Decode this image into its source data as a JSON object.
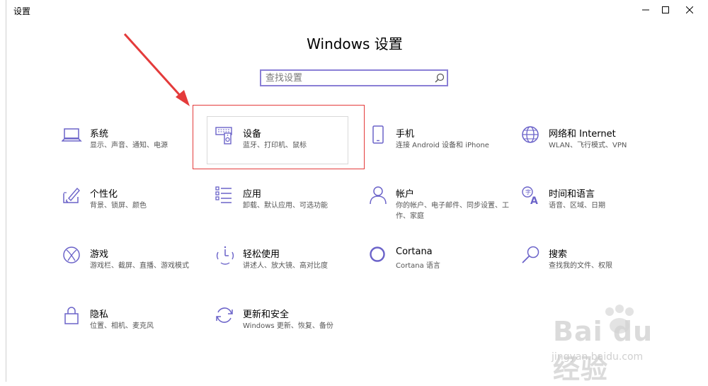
{
  "window": {
    "title": "设置",
    "controls": {
      "minimize": "─",
      "maximize": "☐",
      "close": "✕"
    }
  },
  "header": {
    "title": "Windows 设置",
    "search_placeholder": "查找设置"
  },
  "tiles": [
    {
      "id": "system",
      "title": "系统",
      "subtitle": "显示、声音、通知、电源",
      "icon": "laptop-icon"
    },
    {
      "id": "devices",
      "title": "设备",
      "subtitle": "蓝牙、打印机、鼠标",
      "icon": "keyboard-speaker-icon"
    },
    {
      "id": "phone",
      "title": "手机",
      "subtitle": "连接 Android 设备和 iPhone",
      "icon": "phone-icon"
    },
    {
      "id": "network",
      "title": "网络和 Internet",
      "subtitle": "WLAN、飞行模式、VPN",
      "icon": "globe-icon"
    },
    {
      "id": "personalization",
      "title": "个性化",
      "subtitle": "背景、锁屏、颜色",
      "icon": "pen-tablet-icon"
    },
    {
      "id": "apps",
      "title": "应用",
      "subtitle": "卸载、默认应用、可选功能",
      "icon": "apps-list-icon"
    },
    {
      "id": "accounts",
      "title": "帐户",
      "subtitle": "你的帐户、电子邮件、同步设置、工作、家庭",
      "icon": "person-icon"
    },
    {
      "id": "time",
      "title": "时间和语言",
      "subtitle": "语音、区域、日期",
      "icon": "time-language-icon"
    },
    {
      "id": "gaming",
      "title": "游戏",
      "subtitle": "游戏栏、截屏、直播、游戏模式",
      "icon": "xbox-icon"
    },
    {
      "id": "ease",
      "title": "轻松使用",
      "subtitle": "讲述人、放大镜、高对比度",
      "icon": "ease-of-access-icon"
    },
    {
      "id": "cortana",
      "title": "Cortana",
      "subtitle": "Cortana 语言",
      "icon": "cortana-icon"
    },
    {
      "id": "search",
      "title": "搜索",
      "subtitle": "查找我的文件、权限",
      "icon": "magnifier-icon"
    },
    {
      "id": "privacy",
      "title": "隐私",
      "subtitle": "位置、相机、麦克风",
      "icon": "lock-icon"
    },
    {
      "id": "update",
      "title": "更新和安全",
      "subtitle": "Windows 更新、恢复、备份",
      "icon": "refresh-icon"
    }
  ],
  "colors": {
    "accent": "#6b63c9",
    "annotation": "#e43b3b"
  },
  "watermark": {
    "brand": "Bai du 经验",
    "url": "jingyan.baidu.com"
  }
}
